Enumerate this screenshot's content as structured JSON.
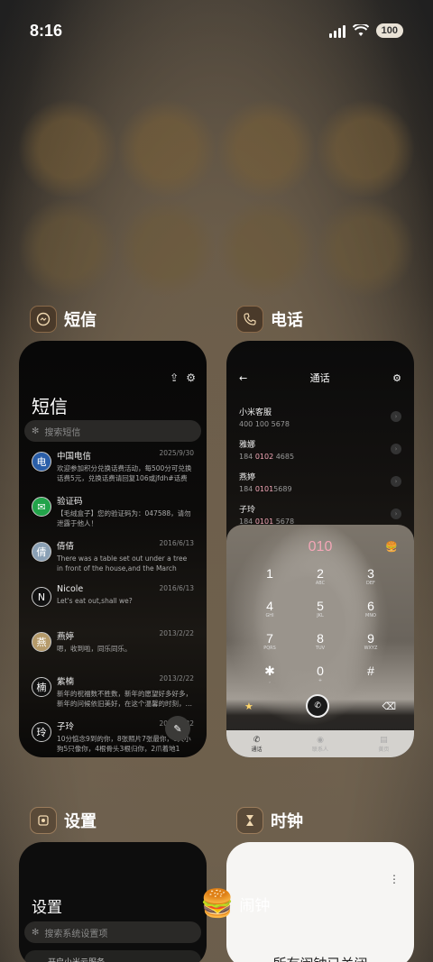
{
  "status": {
    "time": "8:16",
    "battery": "100"
  },
  "sms_app": {
    "name": "短信",
    "title": "短信",
    "search_placeholder": "搜索短信",
    "messages": [
      {
        "sender": "中国电信",
        "date": "2025/9/30",
        "body": "欢迎参加积分兑换话费活动，每500分可兑换话费5元，兑换话费请回复106或jfdh#话费",
        "avatar": "电",
        "avatar_color": "#2a5ea8"
      },
      {
        "sender": "验证码",
        "date": "",
        "body": "【毛绒盒子】您的验证码为：047588，请勿泄露于他人！",
        "avatar": "✉",
        "avatar_color": "#22a34a"
      },
      {
        "sender": "倩倩",
        "date": "2016/6/13",
        "body": "There was a table set out under a tree in front of the house,and the March Hare and",
        "avatar": "倩",
        "avatar_color": "#8aa0b5"
      },
      {
        "sender": "Nicole",
        "date": "2016/6/13",
        "body": "Let's eat out,shall we?",
        "avatar": "N",
        "avatar_color": "#111"
      },
      {
        "sender": "燕婷",
        "date": "2013/2/22",
        "body": "嗯，收到啦，同乐同乐。",
        "avatar": "燕",
        "avatar_color": "#b59a6a"
      },
      {
        "sender": "紫楠",
        "date": "2013/2/22",
        "body": "新年的祝福数不胜数，新年的愿望好多好多，新年的问候依旧美好，在这个温馨的时刻，…",
        "avatar": "楠",
        "avatar_color": "#111"
      },
      {
        "sender": "子玲",
        "date": "2013/2/22",
        "body": "10分惦念9到的你，8张照片7张最你，6只小狗5只像你，4根骨头3根归你，2爪着地1",
        "avatar": "玲",
        "avatar_color": "#111"
      }
    ]
  },
  "phone_app": {
    "name": "电话",
    "title": "通话",
    "contacts": [
      {
        "name": "小米客服",
        "number": "400 100 5678",
        "hl": ""
      },
      {
        "name": "雅娜",
        "number_pre": "184 ",
        "number_hl": "0102",
        "number_post": " 4685"
      },
      {
        "name": "燕婷",
        "number_pre": "184 ",
        "number_hl": "0101",
        "number_post": "5689"
      },
      {
        "name": "子玲",
        "number_pre": "184 ",
        "number_hl": "0101",
        "number_post": " 5678"
      }
    ],
    "dial_display": "010",
    "keys": [
      {
        "digit": "1",
        "letters": ""
      },
      {
        "digit": "2",
        "letters": "ABC"
      },
      {
        "digit": "3",
        "letters": "DEF"
      },
      {
        "digit": "4",
        "letters": "GHI"
      },
      {
        "digit": "5",
        "letters": "JKL"
      },
      {
        "digit": "6",
        "letters": "MNO"
      },
      {
        "digit": "7",
        "letters": "PQRS"
      },
      {
        "digit": "8",
        "letters": "TUV"
      },
      {
        "digit": "9",
        "letters": "WXYZ"
      },
      {
        "digit": "✱",
        "letters": ","
      },
      {
        "digit": "0",
        "letters": "+"
      },
      {
        "digit": "#",
        "letters": ""
      }
    ],
    "tabs": [
      "通话",
      "联系人",
      "黄页"
    ]
  },
  "settings_app": {
    "name": "设置",
    "title": "设置",
    "search_placeholder": "搜索系统设置项",
    "first_row": "开启小米云服务"
  },
  "clock_app": {
    "name": "时钟",
    "floating_label": "闹钟",
    "empty_text": "所有闹钟已关闭"
  }
}
